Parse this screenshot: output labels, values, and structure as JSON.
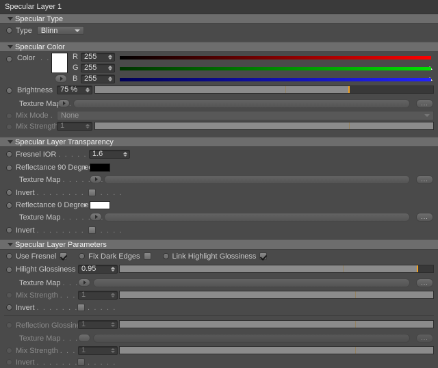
{
  "window": {
    "title": "Specular Layer 1"
  },
  "sections": {
    "type": {
      "title": "Specular Type"
    },
    "color": {
      "title": "Specular Color"
    },
    "transparency": {
      "title": "Specular Layer Transparency"
    },
    "parameters": {
      "title": "Specular Layer Parameters"
    }
  },
  "specular_type": {
    "type_label": "Type",
    "type_value": "Blinn"
  },
  "specular_color": {
    "color_label": "Color",
    "color_leader": ". . . .",
    "swatch_hex": "#ffffff",
    "channels": [
      {
        "name": "R",
        "value": "255",
        "from": "#000000",
        "to": "#ff0000"
      },
      {
        "name": "G",
        "value": "255",
        "from": "#003300",
        "to": "#00e000"
      },
      {
        "name": "B",
        "value": "255",
        "from": "#000055",
        "to": "#2222ff"
      }
    ],
    "brightness_label": "Brightness",
    "brightness_leader": ". .",
    "brightness_value": "75 %",
    "brightness_pct": 75,
    "texture_map_label": "Texture Map",
    "texture_map_leader": ". . . . . . . . . .",
    "texture_map_value": "",
    "browse_label": "...",
    "mix_mode_label": "Mix Mode",
    "mix_mode_leader": ". .",
    "mix_mode_value": "None",
    "mix_strength_label": "Mix Strength",
    "mix_strength_value": "1",
    "mix_strength_pct": 100
  },
  "specular_layer_transparency": {
    "fresnel_ior_label": "Fresnel IOR",
    "fresnel_ior_leader": ". . . . . . . . . . . .",
    "fresnel_ior_value": "1.6",
    "reflectance_90_label": "Reflectance 90 Degree",
    "reflectance_90_hex": "#000000",
    "reflectance_0_label": "Reflectance   0 Degree",
    "reflectance_0_hex": "#ffffff",
    "texture_map_label": "Texture Map",
    "texture_map_leader": ". . . . . . . . . . . .",
    "invert_label": "Invert",
    "invert_leader": ". . . . . . . . . . . . . .",
    "invert_90_checked": false,
    "invert_0_checked": false,
    "browse_label": "..."
  },
  "specular_layer_parameters": {
    "use_fresnel_label": "Use Fresnel",
    "use_fresnel_checked": true,
    "fix_dark_edges_label": "Fix Dark Edges",
    "fix_dark_edges_checked": false,
    "link_highlight_label": "Link Highlight Glossiness",
    "link_highlight_checked": true,
    "hilight_glossiness_label": "Hilight Glossiness",
    "hilight_glossiness_leader": ". . .",
    "hilight_glossiness_value": "0.95",
    "hilight_glossiness_pct": 95,
    "texture_map_label": "Texture Map",
    "texture_map_leader": ". . . . . . . .",
    "mix_strength_label": "Mix Strength",
    "mix_strength_leader": ". . . . . . . .",
    "mix_strength_value": "1",
    "mix_strength_pct": 100,
    "invert_label": "Invert",
    "invert_leader": ". . . . . . . . . . . . .",
    "invert_hilight_checked": false,
    "reflection_glossiness_label": "Reflection Glossiness",
    "reflection_glossiness_value": "1",
    "reflection_glossiness_pct": 100,
    "refl_texture_map_label": "Texture Map",
    "refl_texture_map_leader": ". . . . . . . .",
    "refl_mix_strength_label": "Mix Strength",
    "refl_mix_strength_leader": ". . . . . . . .",
    "refl_mix_strength_value": "1",
    "refl_mix_strength_pct": 100,
    "refl_invert_label": "Invert",
    "refl_invert_leader": ". . . . . . . . . . . . .",
    "refl_invert_checked": false,
    "browse_label": "..."
  },
  "theme": {
    "accent": "#f0a01e",
    "bg": "#4a4a4a",
    "header_bg": "#6d6d6d",
    "title_bg": "#3a3a3a"
  }
}
